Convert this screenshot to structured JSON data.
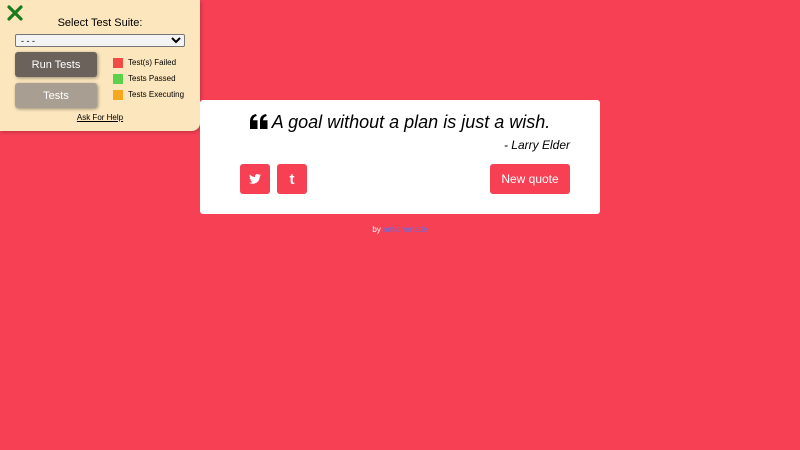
{
  "test_panel": {
    "title": "Select Test Suite:",
    "select_value": "- - -",
    "run_button": "Run Tests",
    "tests_button": "Tests",
    "legend": [
      {
        "label": "Test(s) Failed",
        "color": "#f04c43"
      },
      {
        "label": "Tests Passed",
        "color": "#5bd24a"
      },
      {
        "label": "Tests Executing",
        "color": "#f6a71d"
      }
    ],
    "help_link": "Ask For Help"
  },
  "quote": {
    "text": "A goal without a plan is just a wish.",
    "author": "- Larry Elder",
    "new_quote_button": "New quote"
  },
  "footer": {
    "prefix": "by ",
    "author": "antiaremade"
  },
  "colors": {
    "background": "#f84055",
    "accent": "#f84055",
    "panel": "#fbe6bd",
    "close_icon": "#1b7a1b"
  }
}
